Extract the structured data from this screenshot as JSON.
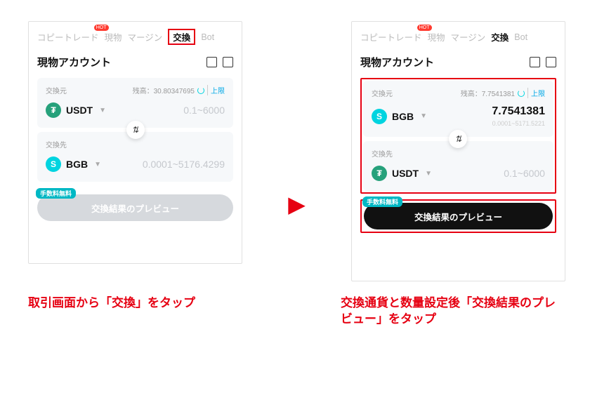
{
  "tabs": {
    "copytrade": "コピートレード",
    "spot": "現物",
    "margin": "マージン",
    "swap": "交換",
    "bot": "Bot",
    "hot": "HOT"
  },
  "account": {
    "title": "現物アカウント"
  },
  "left": {
    "from_label": "交換元",
    "from_balance": "残高：30.80347695",
    "max_label": "上限",
    "from_token": "USDT",
    "from_amount": "0.1~6000",
    "to_label": "交換先",
    "to_token": "BGB",
    "to_amount": "0.0001~5176.4299"
  },
  "right": {
    "from_label": "交換元",
    "from_balance": "残高：7.7541381",
    "max_label": "上限",
    "from_token": "BGB",
    "from_amount": "7.7541381",
    "from_range": "0.0001~5171.5221",
    "to_label": "交換先",
    "to_token": "USDT",
    "to_amount": "0.1~6000"
  },
  "preview": {
    "label": "交換結果のプレビュー",
    "fee_free": "手数料無料"
  },
  "captions": {
    "left": "取引画面から「交換」をタップ",
    "right": "交換通貨と数量設定後「交換結果のプレビュー」をタップ"
  },
  "glyphs": {
    "swap": "⇅"
  }
}
